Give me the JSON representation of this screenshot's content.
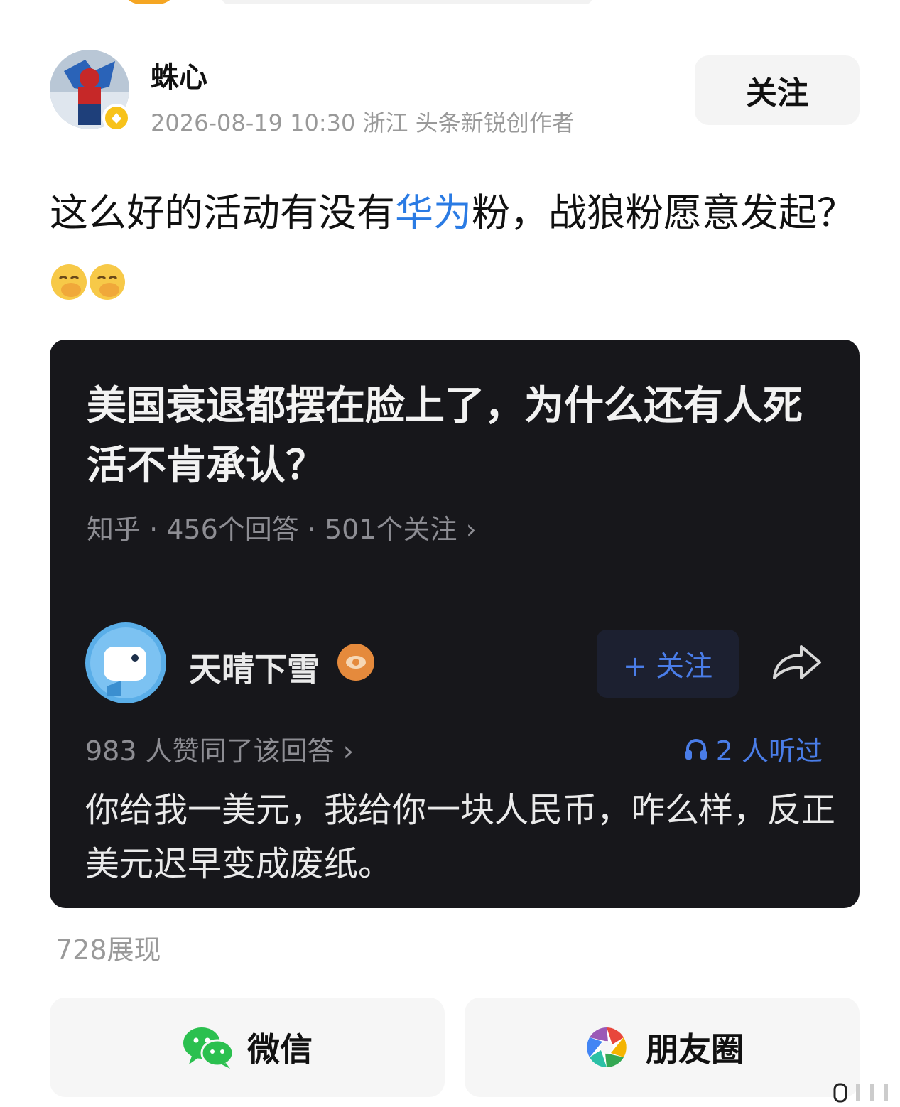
{
  "author": {
    "name": "蛛心",
    "meta": "2026-08-19 10:30 浙江 头条新锐创作者",
    "follow_label": "关注"
  },
  "post": {
    "text_before": "这么好的活动有没有",
    "link_text": "华为",
    "text_after": "粉，战狼粉愿意发起？"
  },
  "card": {
    "question_title": "美国衰退都摆在脸上了，为什么还有人死活不肯承认？",
    "question_meta": "知乎 · 456个回答 · 501个关注 ›",
    "answerer_name": "天晴下雪",
    "answer_follow_label": "+ 关注",
    "agree_text": "983 人赞同了该回答 ›",
    "listened_text": "2 人听过",
    "answer_text": "你给我一美元，我给你一块人民币，咋么样，反正美元迟早变成废纸。"
  },
  "views": "728展现",
  "share": {
    "wechat_label": "微信",
    "moments_label": "朋友圈"
  },
  "icons": {
    "avatar_badge": "creator-badge-icon",
    "answerer_badge": "eye-badge-icon",
    "share": "share-arrow-icon",
    "headphones": "headphones-icon",
    "wechat": "wechat-icon",
    "moments": "moments-aperture-icon"
  },
  "colors": {
    "link": "#2a7be4",
    "card_bg": "#17171b",
    "accent_blue": "#4a7de8",
    "badge_yellow": "#f7c21a"
  }
}
